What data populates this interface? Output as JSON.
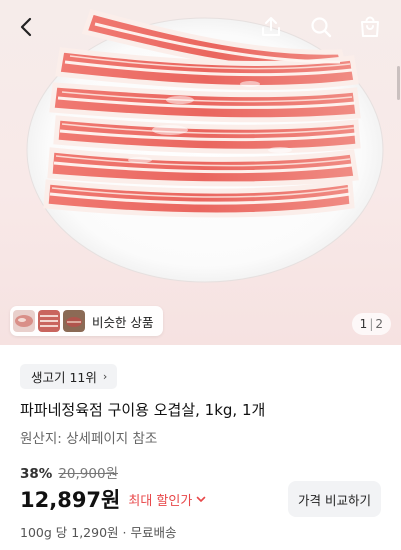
{
  "header": {
    "icons": [
      "back-icon",
      "share-icon",
      "search-icon",
      "cart-icon"
    ]
  },
  "gallery": {
    "similar_label": "비슷한 상품",
    "current_page": "1",
    "total_pages": "2"
  },
  "product": {
    "rank_label": "생고기 11위",
    "title": "파파네정육점 구이용 오겹살, 1kg, 1개",
    "origin": "원산지: 상세페이지 참조",
    "discount_rate": "38%",
    "original_price": "20,900원",
    "price": "12,897원",
    "max_discount_label": "최대 할인가",
    "compare_button": "가격 비교하기",
    "unit_price": "100g 당 1,290원",
    "shipping": "무료배송",
    "separator": " · "
  },
  "colors": {
    "accent_red": "#e8484a",
    "chip_bg": "#f2f3f5"
  }
}
